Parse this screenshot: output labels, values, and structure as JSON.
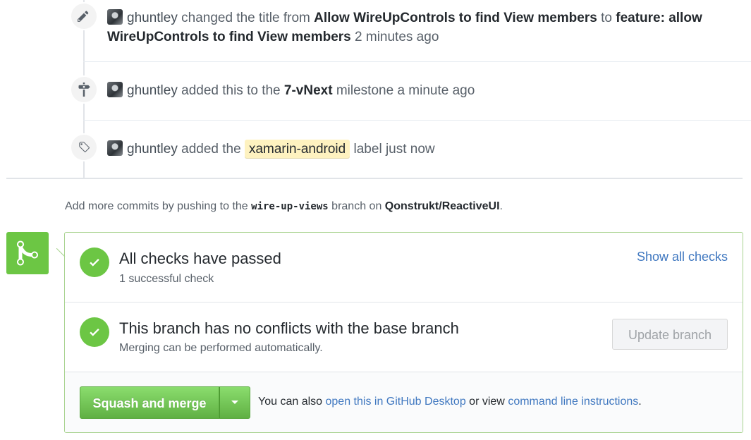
{
  "timeline": {
    "events": [
      {
        "type": "renamed",
        "icon": "pencil-icon",
        "author": "ghuntley",
        "action": "changed the title from",
        "old_title": "Allow WireUpControls to find View members",
        "to_word": "to",
        "new_title": "feature: allow WireUpControls to find View members",
        "time": "2 minutes ago"
      },
      {
        "type": "milestoned",
        "icon": "milestone-icon",
        "author": "ghuntley",
        "action": "added this to the",
        "milestone": "7-vNext",
        "suffix": "milestone",
        "time": "a minute ago"
      },
      {
        "type": "labeled",
        "icon": "tag-icon",
        "author": "ghuntley",
        "action": "added the",
        "label": "xamarin-android",
        "label_color": "#fef2c0",
        "suffix": "label",
        "time": "just now"
      }
    ]
  },
  "push_hint": {
    "prefix": "Add more commits by pushing to the",
    "branch": "wire-up-views",
    "middle": "branch on",
    "repo": "Qonstrukt/ReactiveUI",
    "suffix": "."
  },
  "merge_box": {
    "icon": "git-merge-icon",
    "accent": "#6cc644",
    "checks": {
      "title": "All checks have passed",
      "subtitle": "1 successful check",
      "show_all_label": "Show all checks"
    },
    "conflicts": {
      "title": "This branch has no conflicts with the base branch",
      "subtitle": "Merging can be performed automatically.",
      "update_button_label": "Update branch"
    },
    "action": {
      "merge_button_label": "Squash and merge",
      "alt_prefix": "You can also",
      "desktop_link": "open this in GitHub Desktop",
      "alt_middle": "or view",
      "cli_link": "command line instructions",
      "alt_suffix": "."
    }
  }
}
